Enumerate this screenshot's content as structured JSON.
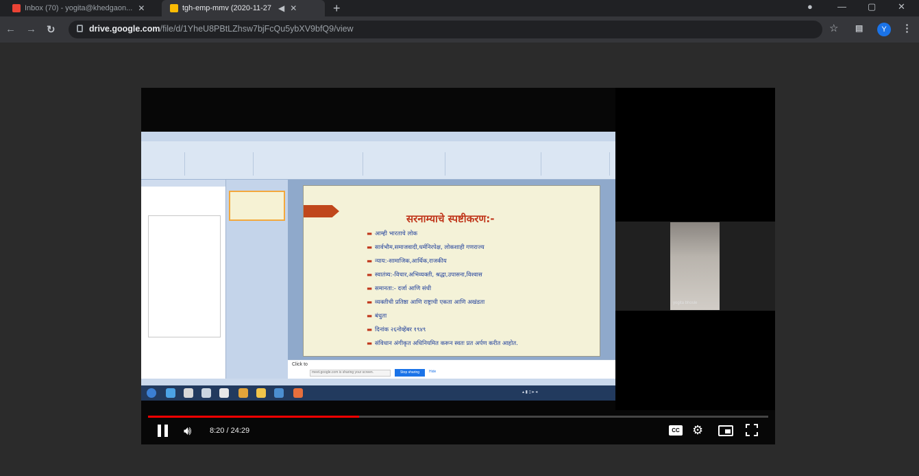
{
  "browser": {
    "tabs": [
      {
        "title": "Inbox (70) - yogita@khedgaon...",
        "active": false,
        "favicon_color": "#ea4335"
      },
      {
        "title": "tgh-emp-mmv (2020-11-27",
        "active": true,
        "favicon_color": "#fbbc04"
      }
    ],
    "url_host": "drive.google.com",
    "url_path": "/file/d/1YheU8PBtLZhsw7bjFcQu5ybXV9bfQ9/view",
    "avatar_letter": "Y"
  },
  "slide": {
    "title": "सरनाम्याचे स्पष्टीकरण:-",
    "bullets": [
      "आम्ही भारताचे लोक",
      "सार्वभौम,समाजवादी,धर्मनिरपेक्ष, लोकशाही गणराज्य",
      "न्याय:-सामाजिक,आर्थिक,राजकीय",
      "स्वातंत्र्य:-विचार,अभिव्यक्ती, श्रद्धा,उपासना,विश्वास",
      "समानता:- दर्जा आणि संधी",
      "व्यक्तीची प्रतिष्ठा आणि राष्ट्राची एकता आणि अखंडता",
      "बंधुता",
      "दिनांक २६नोव्हेंबर १९४९",
      "संविधान अंगीकृत अधिनियमित करून स्वतः प्रत अर्पण करीत आहोत."
    ]
  },
  "notes": {
    "label": "Click to",
    "input_value": "meet.google.com is sharing your screen.",
    "stop_button": "Stop sharing",
    "hide_link": "Hide"
  },
  "participant": {
    "name": "yogita bhosle"
  },
  "player": {
    "time": "8:20 / 24:29",
    "progress": 0.34,
    "cc_label": "CC"
  }
}
